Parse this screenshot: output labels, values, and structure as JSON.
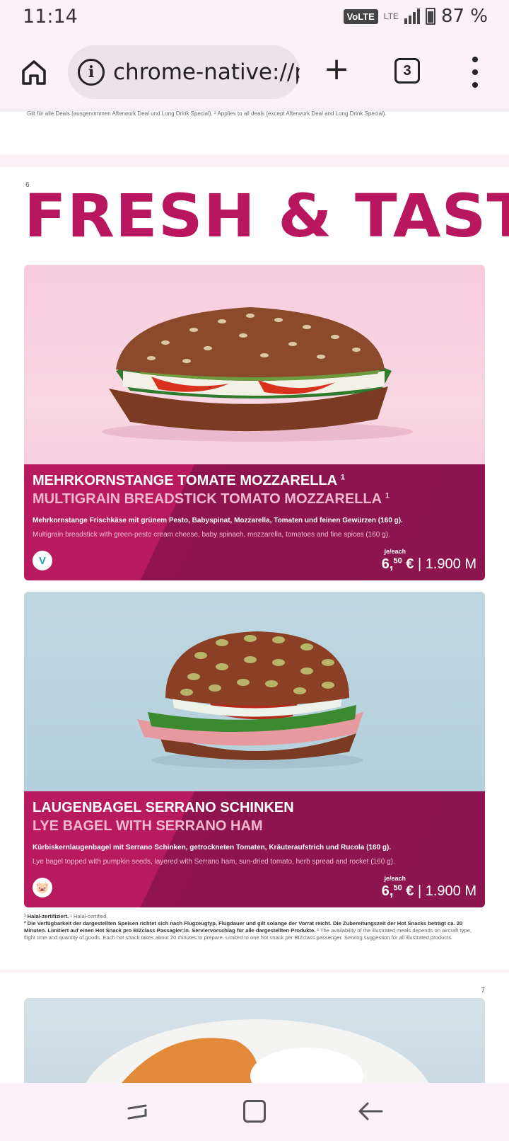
{
  "status_bar": {
    "time": "11:14",
    "volte": "VoLTE",
    "lte": "LTE",
    "battery": "87 %"
  },
  "browser": {
    "url": "chrome-native://p",
    "tab_count": "3",
    "new_tab": "+",
    "info": "i"
  },
  "document": {
    "top_fragment": "Gilt für alle Deals (ausgenommen Afterwork Deal und Long Drink Special).  ² Applies to all deals (except Afterwork Deal and Long Drink Special).",
    "page_number": "6",
    "headline": "FRESH & TASTY",
    "products": [
      {
        "name_de": "MEHRKORNSTANGE TOMATE MOZZARELLA",
        "name_en": "MULTIGRAIN BREADSTICK TOMATO MOZZARELLA",
        "footnote_mark": "1",
        "desc_de": "Mehrkornstange Frischkäse mit grünem Pesto, Babyspinat, Mozzarella, Tomaten und feinen Gewürzen (160 g).",
        "desc_en": "Multigrain breadstick with green-pesto cream cheese, baby spinach, mozzarella, tomatoes and fine spices (160 g).",
        "badge": "V",
        "price_each": "je/each",
        "price_euro": "6,",
        "price_cents": "50",
        "price_currency": "€",
        "price_miles": "| 1.900 M"
      },
      {
        "name_de": "LAUGENBAGEL SERRANO SCHINKEN",
        "name_en": "LYE BAGEL WITH SERRANO HAM",
        "desc_de": "Kürbiskernlaugenbagel mit Serrano Schinken, getrockneten Tomaten, Kräuteraufstrich und Rucola (160 g).",
        "desc_en": "Lye bagel topped with pumpkin seeds, layered with Serrano ham, sun-dried tomato, herb spread and rocket (160 g).",
        "badge": "🐷",
        "price_each": "je/each",
        "price_euro": "6,",
        "price_cents": "50",
        "price_currency": "€",
        "price_miles": "| 1.900 M"
      }
    ],
    "footnote_1_de": "¹ Halal-zertifiziert.",
    "footnote_1_en": "¹ Halal-certified.",
    "footnote_2_de": "² Die Verfügbarkeit der dargestellten Speisen richtet sich nach Flugzeugtyp, Flugdauer und gilt solange der Vorrat reicht. Die Zubereitungszeit der Hot Snacks beträgt ca. 20 Minuten. Limitiert auf einen Hot Snack pro BIZclass Passagier:in. Serviervorschlag für alle dargestellten Produkte.",
    "footnote_2_en": "² The availability of the illustrated meals depends on aircraft type, flight time and quantity of goods. Each hot snack takes about 20 minutes to prepare. Limited to one hot snack per BIZclass passenger. Serving suggestion for all illustrated products.",
    "next_page_number": "7"
  },
  "colors": {
    "brand": "#b8175f",
    "brand_dark": "#8c154f",
    "card_1_bg": "#f7ccdd",
    "card_2_bg": "#b3d0dc"
  }
}
